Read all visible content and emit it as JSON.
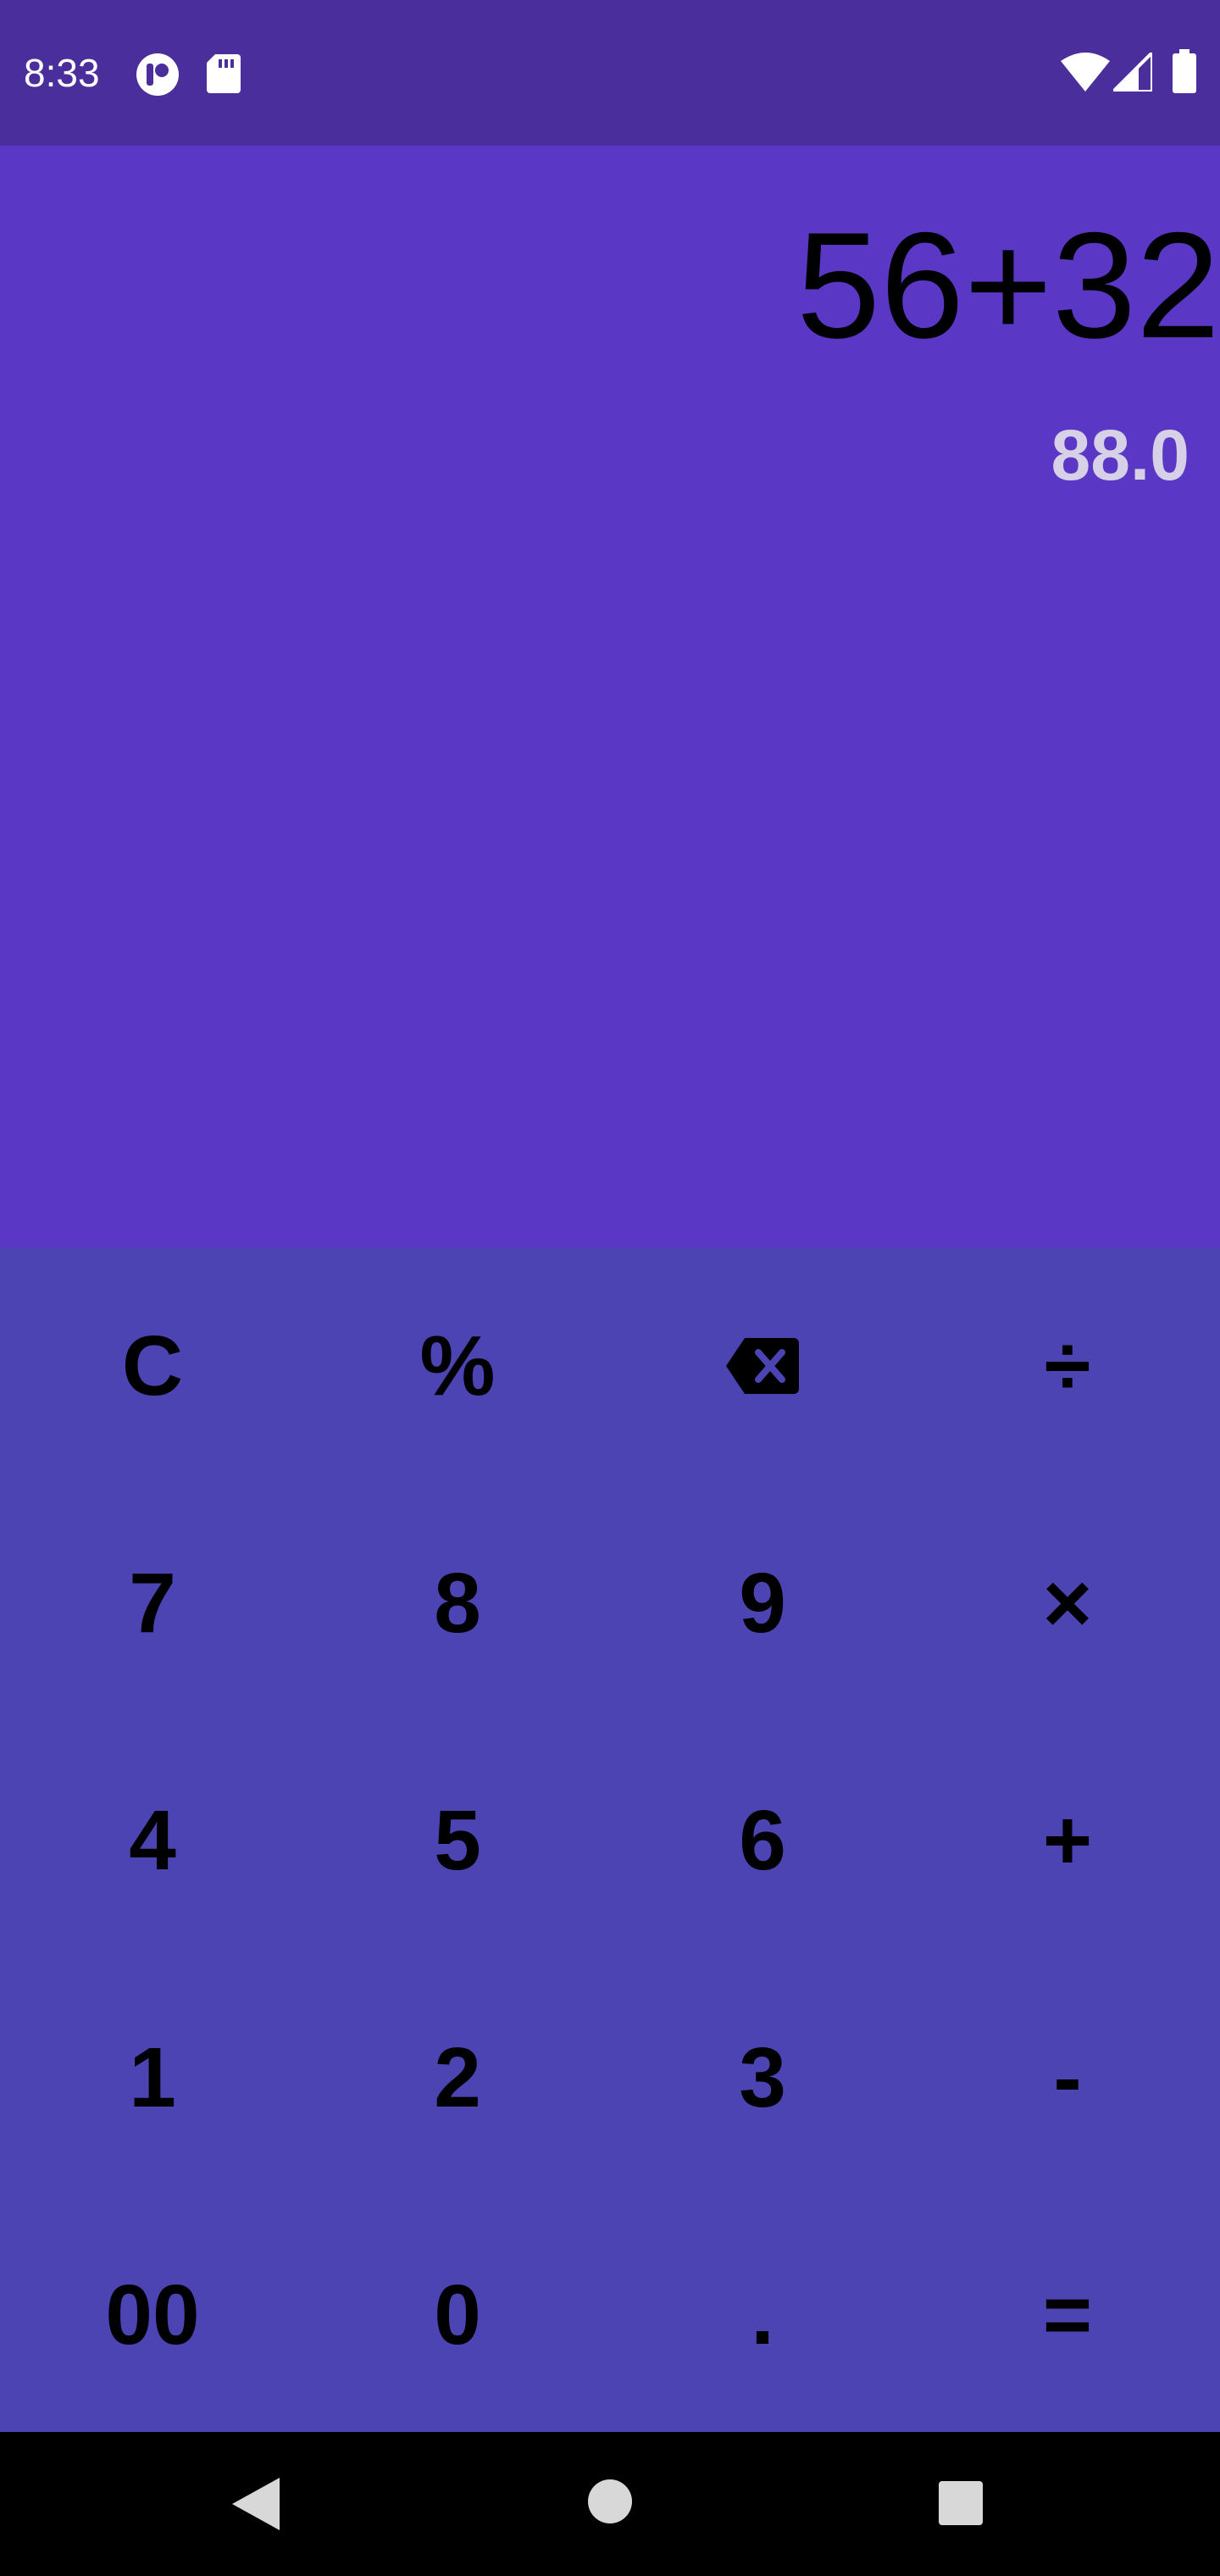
{
  "status_bar": {
    "time": "8:33",
    "icons": [
      "app-badge-icon",
      "sd-card-icon",
      "wifi-icon",
      "signal-icon",
      "battery-icon"
    ]
  },
  "display": {
    "expression": "56+32",
    "result": "88.0"
  },
  "keypad": {
    "rows": [
      [
        "C",
        "%",
        "backspace",
        "÷"
      ],
      [
        "7",
        "8",
        "9",
        "×"
      ],
      [
        "4",
        "5",
        "6",
        "+"
      ],
      [
        "1",
        "2",
        "3",
        "-"
      ],
      [
        "00",
        "0",
        ".",
        "="
      ]
    ]
  },
  "nav_bar": {
    "icons": [
      "back-icon",
      "home-icon",
      "recents-icon"
    ]
  },
  "colors": {
    "status_bar": "#4a2e9c",
    "display_background": "#5a37c5",
    "keypad_background": "#4c44b3",
    "result_text": "#d6d1e6",
    "nav_bar": "#000000"
  }
}
